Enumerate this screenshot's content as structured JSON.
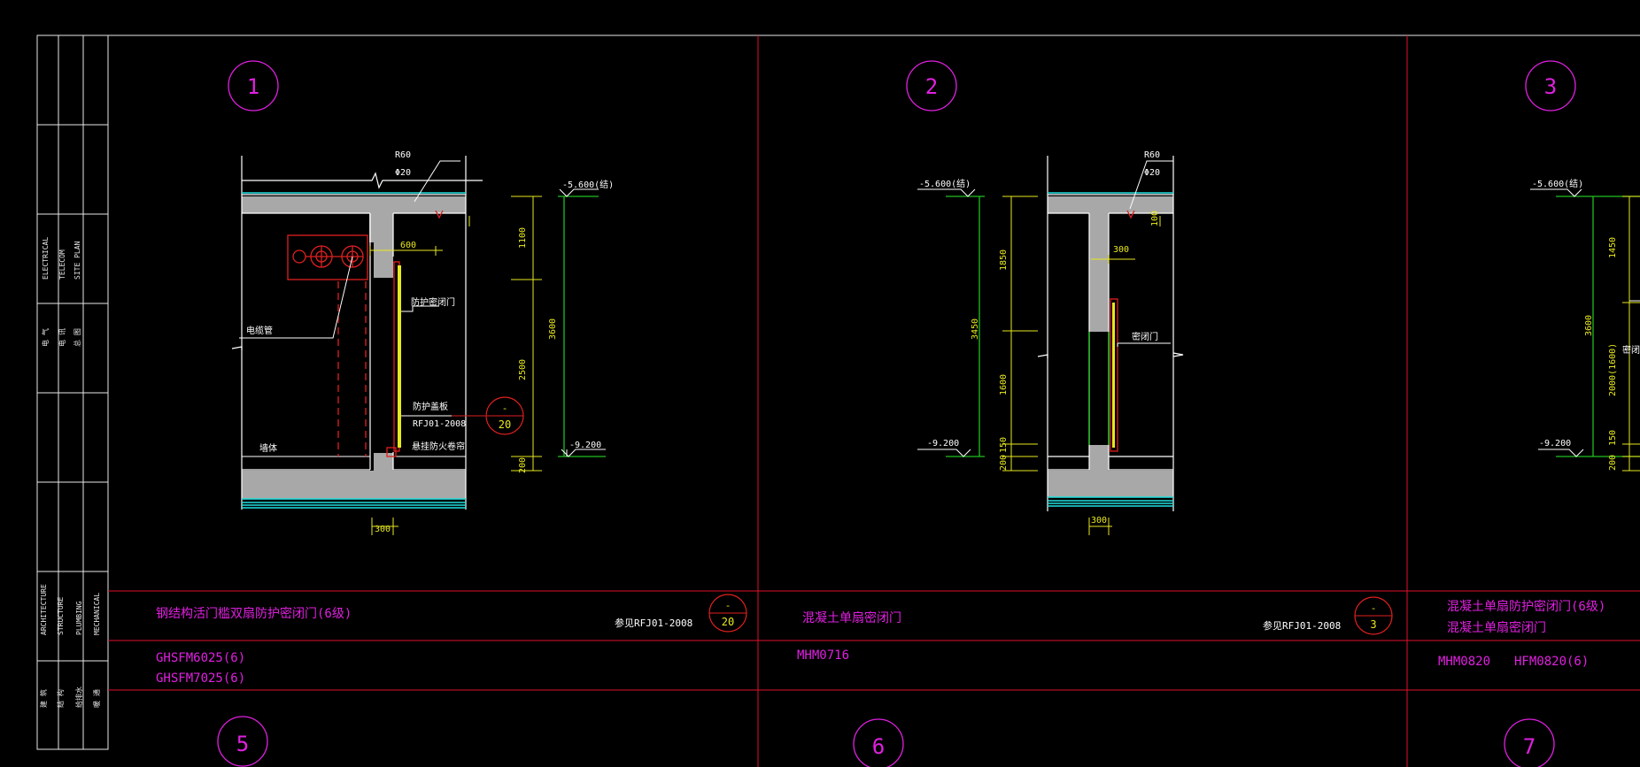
{
  "colors": {
    "background": "#000000",
    "frame": "#e8e8e8",
    "grid_line": "#e0102a",
    "label_magenta": "#e020e0",
    "dimension_yellow": "#e8e820",
    "leader_white": "#ffffff",
    "elevation_green": "#20c020",
    "concrete_fill": "#a8a8a8",
    "cyan_edge": "#20e0e0",
    "door_red": "#e02020"
  },
  "side_panel": {
    "disciplines_top": [
      "ELECTRICAL",
      "TELECOM",
      "SITE PLAN"
    ],
    "cn_top": [
      "电 气",
      "电 讯",
      "总 图"
    ],
    "disciplines_bottom": [
      "ARCHITECTURE",
      "STRUCTURE",
      "PLUMBING",
      "MECHANICAL"
    ],
    "cn_bottom": [
      "建 筑",
      "结 构",
      "给排水",
      "暖 通"
    ]
  },
  "details": [
    {
      "number": "1",
      "title": "钢结构活门槛双扇防护密闭门(6级)",
      "ref_text": "参见RFJ01-2008",
      "ref_marker": {
        "top": "-",
        "bottom": "20"
      },
      "codes": [
        "GHSFM6025(6)",
        "GHSFM7025(6)"
      ],
      "top_elev": "-5.600(结)",
      "bot_elev": "-9.200",
      "rebar": [
        "R60",
        "Φ20"
      ],
      "dims_h": [
        "600",
        "300"
      ],
      "dims_v": [
        "1100",
        "2500",
        "200",
        "3600"
      ],
      "callouts": [
        "防护密闭门",
        "防护盖板",
        "RFJ01-2008",
        "悬挂防火卷帘",
        "墙体",
        "电缆管"
      ],
      "marker": {
        "top": "-",
        "bottom": "20"
      }
    },
    {
      "number": "2",
      "title": "混凝土单扇密闭门",
      "ref_text": "参见RFJ01-2008",
      "ref_marker": {
        "top": "-",
        "bottom": "3"
      },
      "codes": [
        "MHM0716"
      ],
      "top_elev": "-5.600(结)",
      "bot_elev": "-9.200",
      "rebar": [
        "R60",
        "Φ20"
      ],
      "dims_h": [
        "300",
        "300"
      ],
      "dims_v": [
        "1850",
        "1600",
        "150",
        "200",
        "3450",
        "100"
      ],
      "callouts": [
        "密闭门"
      ]
    },
    {
      "number": "3",
      "title_lines": [
        "混凝土单扇防护密闭门(6级)",
        "混凝土单扇密闭门"
      ],
      "codes": [
        "MHM0820",
        "HFM0820(6)"
      ],
      "top_elev": "-5.600(结)",
      "bot_elev": "-9.200",
      "dims_v": [
        "1450",
        "3600",
        "2000(1600)",
        "150",
        "200"
      ],
      "callouts": [
        "密闭门"
      ]
    }
  ],
  "bottom_row": [
    "5",
    "6",
    "7"
  ]
}
